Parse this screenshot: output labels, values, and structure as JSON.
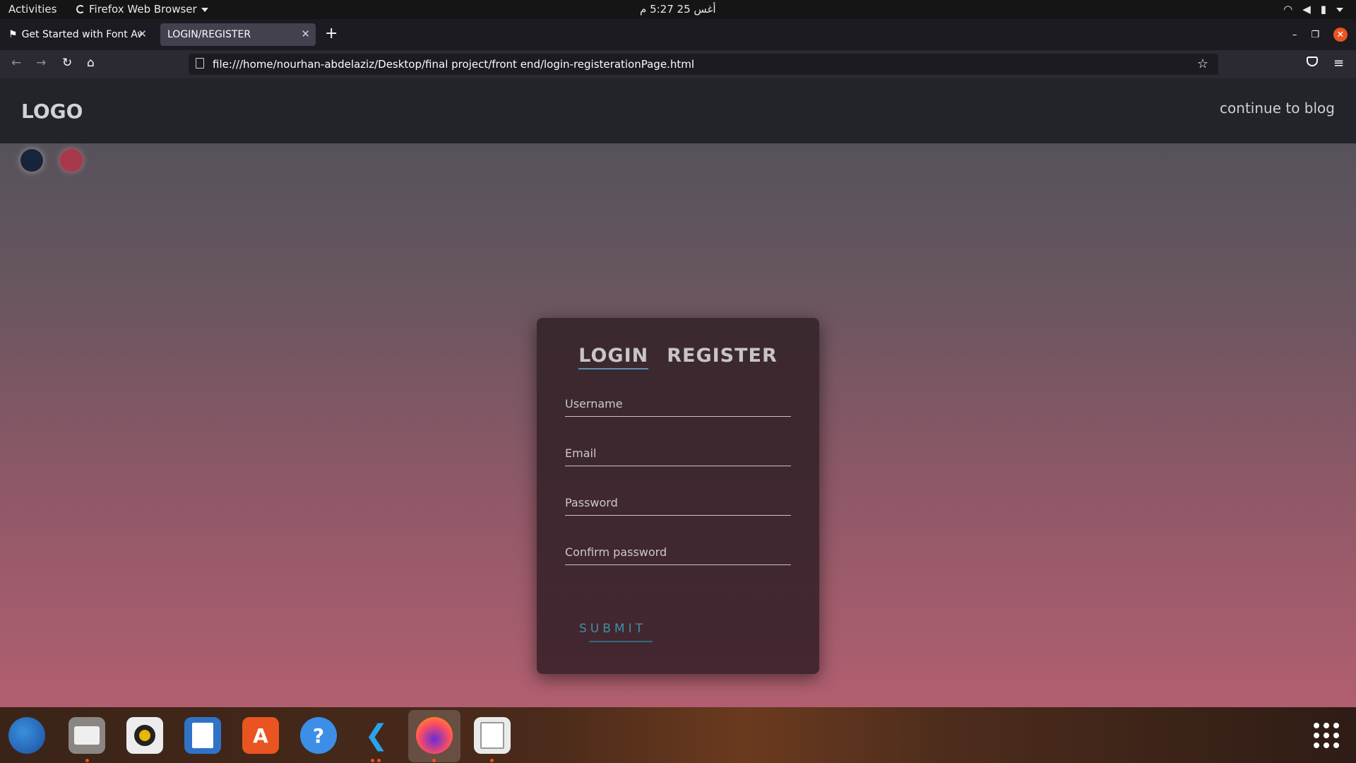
{
  "topbar": {
    "activities": "Activities",
    "app_name": "Firefox Web Browser",
    "clock": "أغس 25  5:27 م"
  },
  "browser": {
    "tabs": [
      {
        "label": "Get Started with Font Aw"
      },
      {
        "label": "LOGIN/REGISTER"
      }
    ],
    "url": "file:///home/nourhan-abdelaziz/Desktop/final project/front end/login-registerationPage.html"
  },
  "site": {
    "logo": "LOGO",
    "continue_link": "continue to blog",
    "theme_colors": {
      "dark": "#17243a",
      "red": "#a8384a"
    }
  },
  "form": {
    "tabs": {
      "login": "LOGIN",
      "register": "REGISTER"
    },
    "username_placeholder": "Username",
    "email_placeholder": "Email",
    "password_placeholder": "Password",
    "confirm_placeholder": "Confirm password",
    "submit": "SUBMIT"
  },
  "dock": {
    "apps": [
      "thunderbird-icon",
      "files-icon",
      "rhythmbox-icon",
      "writer-icon",
      "software-icon",
      "help-icon",
      "vscode-icon",
      "firefox-icon",
      "document-viewer-icon"
    ],
    "help_glyph": "?"
  }
}
